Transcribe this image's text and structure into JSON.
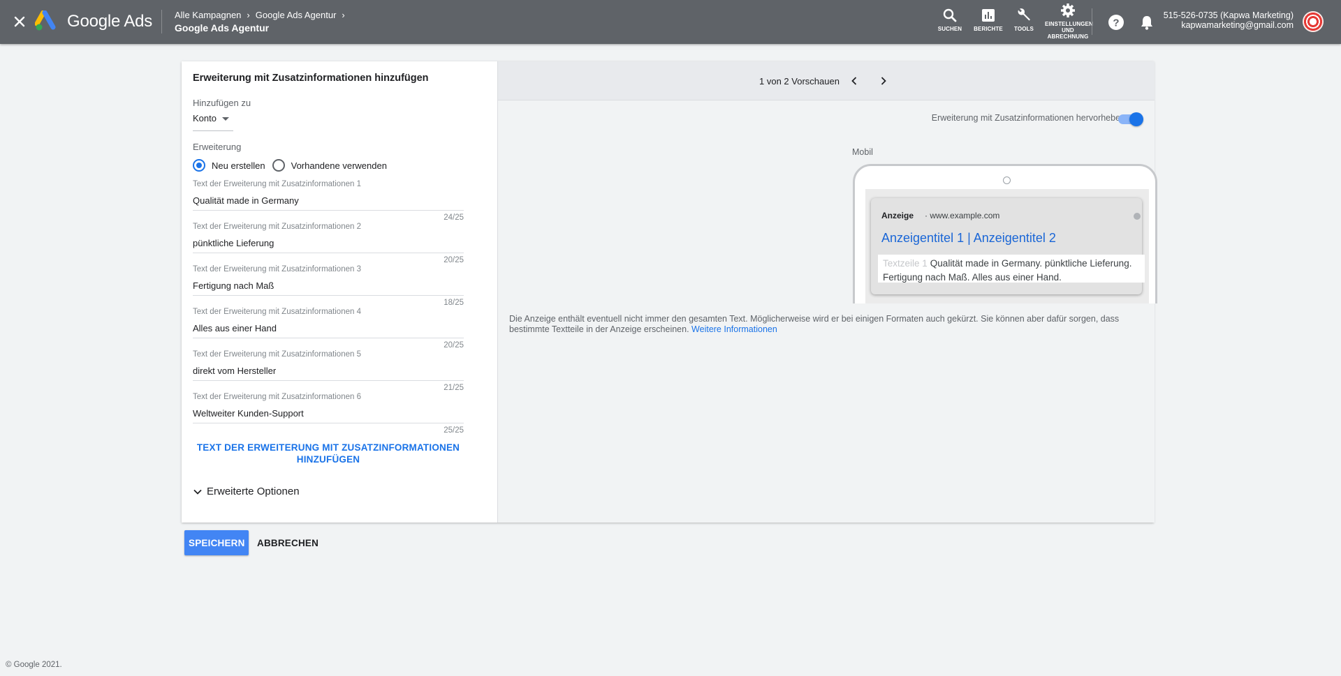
{
  "topbar": {
    "brand": "Google Ads",
    "breadcrumb": [
      "Alle Kampagnen",
      "Google Ads Agentur"
    ],
    "current": "Google Ads Agentur",
    "tools": [
      {
        "id": "search",
        "label": "SUCHEN"
      },
      {
        "id": "reports",
        "label": "BERICHTE"
      },
      {
        "id": "tools",
        "label": "TOOLS"
      },
      {
        "id": "settings",
        "label": "EINSTELLUNGEN UND ABRECHNUNG"
      }
    ],
    "account_phone": "515-526-0735 (Kapwa Marketing)",
    "account_email": "kapwamarketing@gmail.com"
  },
  "form": {
    "title": "Erweiterung mit Zusatzinformationen hinzufügen",
    "add_to_label": "Hinzufügen zu",
    "add_to_value": "Konto",
    "extension_label": "Erweiterung",
    "radio_new": "Neu erstellen",
    "radio_existing": "Vorhandene verwenden",
    "fields": [
      {
        "label": "Text der Erweiterung mit Zusatzinformationen 1",
        "value": "Qualität made in Germany",
        "count": "24/25"
      },
      {
        "label": "Text der Erweiterung mit Zusatzinformationen 2",
        "value": "pünktliche Lieferung",
        "count": "20/25"
      },
      {
        "label": "Text der Erweiterung mit Zusatzinformationen 3",
        "value": "Fertigung nach Maß",
        "count": "18/25"
      },
      {
        "label": "Text der Erweiterung mit Zusatzinformationen 4",
        "value": "Alles aus einer Hand",
        "count": "20/25"
      },
      {
        "label": "Text der Erweiterung mit Zusatzinformationen 5",
        "value": "direkt vom Hersteller",
        "count": "21/25"
      },
      {
        "label": "Text der Erweiterung mit Zusatzinformationen 6",
        "value": "Weltweiter Kunden-Support",
        "count": "25/25"
      }
    ],
    "add_link": "TEXT DER ERWEITERUNG MIT ZUSATZINFORMATIONEN HINZUFÜGEN",
    "advanced": "Erweiterte Optionen"
  },
  "preview": {
    "count": "1 von 2 Vorschauen",
    "highlight_label": "Erweiterung mit Zusatzinformationen hervorheben",
    "device_label": "Mobil",
    "ad_badge": "Anzeige",
    "ad_url": "www.example.com",
    "ad_title": "Anzeigentitel 1 | Anzeigentitel 2",
    "ad_ghost": "Textzeile 1",
    "ad_desc": "Qualität made in Germany. pünktliche Lieferung. Fertigung nach Maß. Alles aus einer Hand.",
    "note": "Die Anzeige enthält eventuell nicht immer den gesamten Text. Möglicherweise wird er bei einigen Formaten auch gekürzt. Sie können aber dafür sorgen, dass bestimmte Textteile in der Anzeige erscheinen.",
    "note_link": "Weitere Informationen"
  },
  "actions": {
    "save": "SPEICHERN",
    "cancel": "ABBRECHEN"
  },
  "footer": "© Google 2021."
}
